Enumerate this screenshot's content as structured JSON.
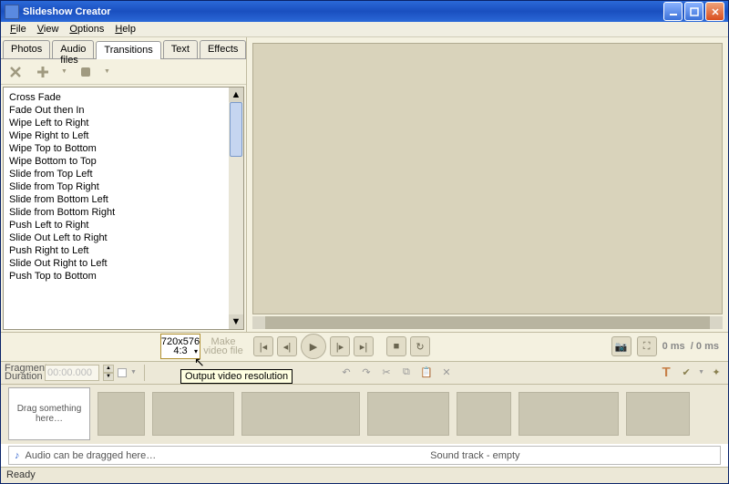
{
  "window": {
    "title": "Slideshow Creator"
  },
  "menu": {
    "file": "File",
    "view": "View",
    "options": "Options",
    "help": "Help"
  },
  "tabs": {
    "photos": "Photos",
    "audio": "Audio files",
    "transitions": "Transitions",
    "text": "Text",
    "effects": "Effects"
  },
  "transitions": [
    "Cross Fade",
    "Fade Out then In",
    "Wipe Left to Right",
    "Wipe Right to Left",
    "Wipe Top to Bottom",
    "Wipe Bottom to Top",
    "Slide from Top Left",
    "Slide from Top Right",
    "Slide from Bottom Left",
    "Slide from Bottom Right",
    "Push Left to Right",
    "Slide Out Left to Right",
    "Push Right to Left",
    "Slide Out Right to Left",
    "Push Top to Bottom"
  ],
  "resolution": {
    "dims": "720x576",
    "aspect": "4:3"
  },
  "makeVideo": {
    "line1": "Make",
    "line2": "video file"
  },
  "tooltip": "Output video resolution",
  "time": {
    "current": "0 ms",
    "sep": "/",
    "total": "0 ms"
  },
  "fragment": {
    "label1": "Fragment",
    "label2": "Duration",
    "value": "00:00.000"
  },
  "dragSlot": "Drag something here…",
  "audio": {
    "dragText": "Audio can be dragged here…",
    "trackLabel": "Sound track - empty"
  },
  "status": "Ready"
}
